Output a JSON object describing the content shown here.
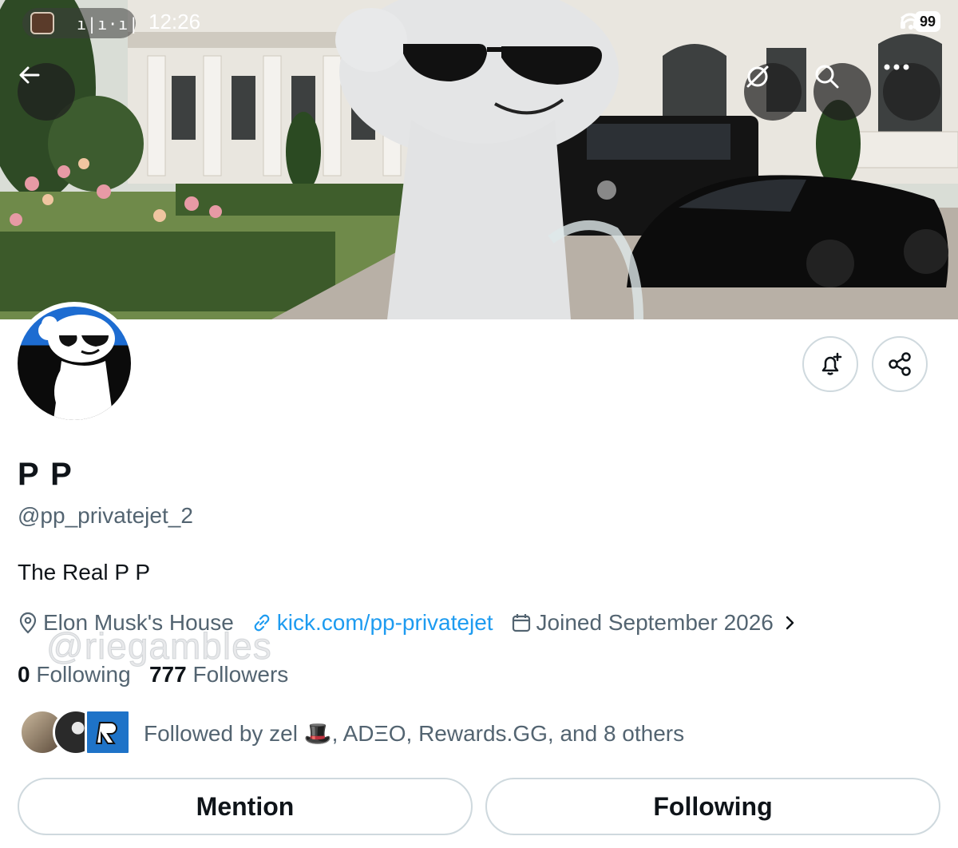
{
  "status_bar": {
    "time": "12:26",
    "battery": "99",
    "wave_glyph": "ı|ı·ı|"
  },
  "header": {
    "back_icon": "arrow-left-icon",
    "action_icons": [
      "grok-icon",
      "search-icon",
      "more-icon"
    ]
  },
  "profile": {
    "display_name": "P P",
    "handle": "@pp_privatejet_2",
    "bio": "The Real P P",
    "location": "Elon Musk's House",
    "link": "kick.com/pp-privatejet",
    "joined": "Joined September 2026",
    "watermark": "@riegambles",
    "following_count": "0",
    "following_label": "Following",
    "followers_count": "777",
    "followers_label": "Followers",
    "followed_by": "Followed by zel 🎩, ADΞO, Rewards.GG, and 8 others"
  },
  "actions": {
    "notify_icon": "bell-plus-icon",
    "share_icon": "share-icon",
    "mention_label": "Mention",
    "following_label": "Following"
  },
  "colors": {
    "link": "#1d9bf0",
    "muted": "#536471",
    "text": "#0f1419",
    "border": "#cfd9de"
  }
}
